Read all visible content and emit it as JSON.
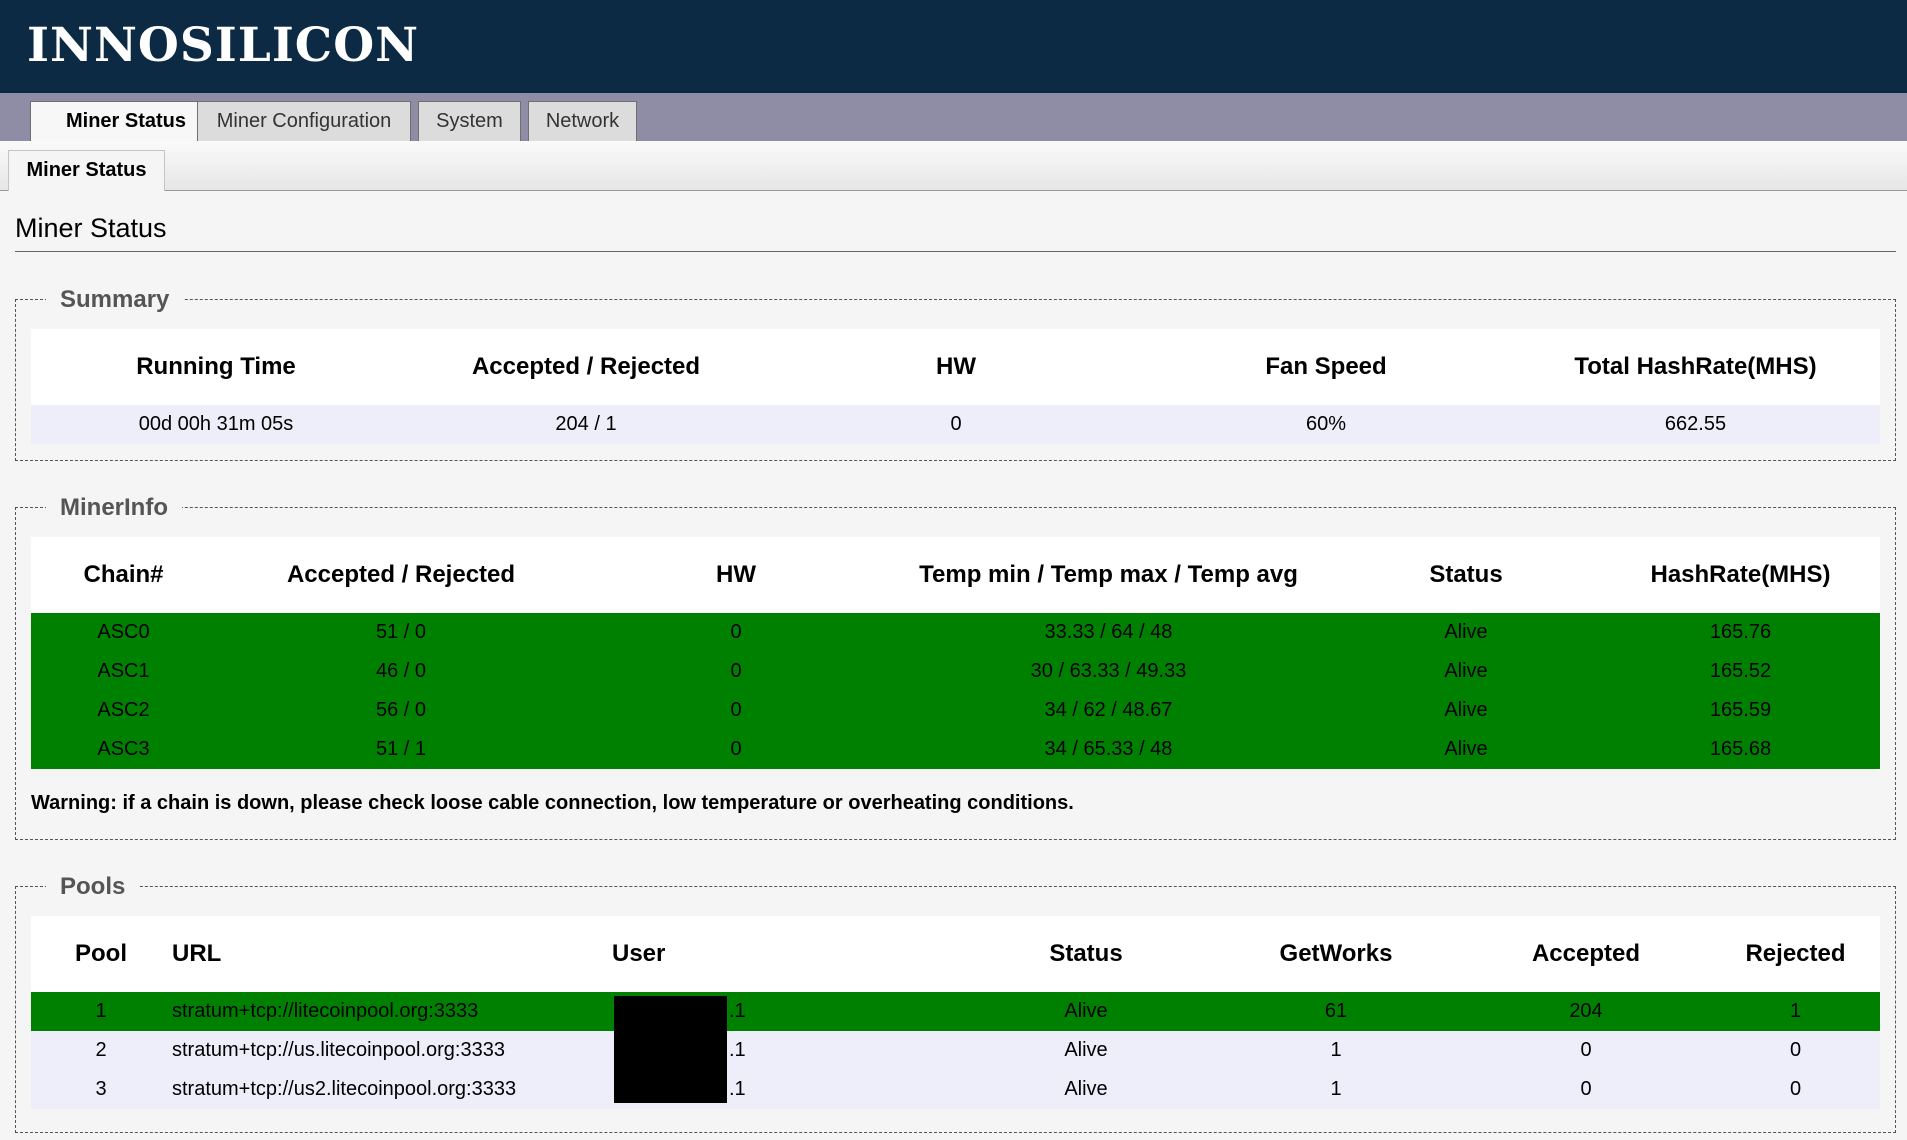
{
  "brand": "INNOSILICON",
  "tabs": [
    "Miner Status",
    "Miner Configuration",
    "System",
    "Network"
  ],
  "subtab": "Miner Status",
  "page_title": "Miner Status",
  "summary": {
    "legend": "Summary",
    "headers": [
      "Running Time",
      "Accepted / Rejected",
      "HW",
      "Fan Speed",
      "Total HashRate(MHS)"
    ],
    "row": [
      "00d 00h 31m 05s",
      "204 / 1",
      "0",
      "60%",
      "662.55"
    ]
  },
  "minerinfo": {
    "legend": "MinerInfo",
    "headers": [
      "Chain#",
      "Accepted / Rejected",
      "HW",
      "Temp min / Temp max / Temp avg",
      "Status",
      "HashRate(MHS)"
    ],
    "rows": [
      [
        "ASC0",
        "51 / 0",
        "0",
        "33.33 / 64 / 48",
        "Alive",
        "165.76"
      ],
      [
        "ASC1",
        "46 / 0",
        "0",
        "30 / 63.33 / 49.33",
        "Alive",
        "165.52"
      ],
      [
        "ASC2",
        "56 / 0",
        "0",
        "34 / 62 / 48.67",
        "Alive",
        "165.59"
      ],
      [
        "ASC3",
        "51 / 1",
        "0",
        "34 / 65.33 / 48",
        "Alive",
        "165.68"
      ]
    ],
    "warning": "Warning: if a chain is down, please check loose cable connection, low temperature or overheating conditions."
  },
  "pools": {
    "legend": "Pools",
    "headers": [
      "Pool",
      "URL",
      "User",
      "Status",
      "GetWorks",
      "Accepted",
      "Rejected"
    ],
    "rows": [
      [
        "1",
        "stratum+tcp://litecoinpool.org:3333",
        ".1",
        "Alive",
        "61",
        "204",
        "1"
      ],
      [
        "2",
        "stratum+tcp://us.litecoinpool.org:3333",
        ".1",
        "Alive",
        "1",
        "0",
        "0"
      ],
      [
        "3",
        "stratum+tcp://us2.litecoinpool.org:3333",
        ".1",
        "Alive",
        "1",
        "0",
        "0"
      ]
    ]
  },
  "colors": {
    "header_bg": "#0c2a44",
    "tabbar_bg": "#8f8ca6",
    "alive_green": "#008000",
    "row_light": "#eeeefb"
  }
}
